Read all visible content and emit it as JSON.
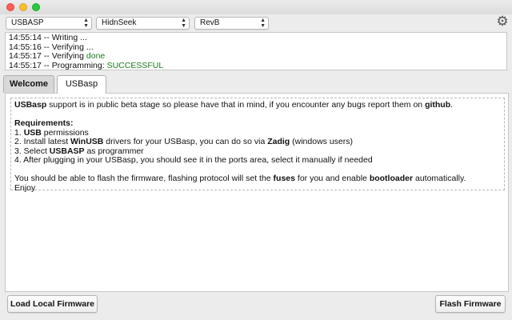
{
  "window": {
    "controls": {
      "close": "close",
      "minimize": "minimize",
      "zoom": "zoom"
    }
  },
  "toolbar": {
    "programmer": "USBASP",
    "firmware": "HidnSeek",
    "revision": "RevB",
    "settings_icon": "gear-icon"
  },
  "log": [
    {
      "time": "14:55:14",
      "sep": " -- ",
      "text": "Writing ...",
      "status": ""
    },
    {
      "time": "14:55:16",
      "sep": " -- ",
      "text": "Verifying ...",
      "status": ""
    },
    {
      "time": "14:55:17",
      "sep": " -- ",
      "text": "Verifying ",
      "status": "done"
    },
    {
      "time": "14:55:17",
      "sep": " -- ",
      "text": "Programming: ",
      "status": "SUCCESSFUL"
    }
  ],
  "tabs": [
    {
      "label": "Welcome"
    },
    {
      "label": "USBasp"
    }
  ],
  "notice": {
    "intro": {
      "b1": "USBasp",
      "t1": " support is in public beta stage so please have that in mind, if you encounter any bugs report them on ",
      "b2": "github",
      "t2": "."
    },
    "requirements_title": "Requirements:",
    "items": [
      {
        "pre": "1. ",
        "bold": "USB",
        "post": " permissions",
        "pre2": "",
        "bold2": "",
        "post2": ""
      },
      {
        "pre": "2. Install latest ",
        "bold": "WinUSB",
        "post": " drivers for your USBasp, you can do so via ",
        "pre2": "",
        "bold2": "Zadig",
        "post2": " (windows users)"
      },
      {
        "pre": "3. Select ",
        "bold": "USBASP",
        "post": " as programmer",
        "pre2": "",
        "bold2": "",
        "post2": ""
      },
      {
        "pre": "4. After plugging in your USBasp, you should see it in the ports area, select it manually if needed",
        "bold": "",
        "post": "",
        "pre2": "",
        "bold2": "",
        "post2": ""
      }
    ],
    "closing": {
      "t1": "You should be able to flash the firmware, flashing protocol will set the ",
      "b1": "fuses",
      "t2": " for you and enable ",
      "b2": "bootloader",
      "t3": " automatically."
    },
    "signoff": "Enjoy"
  },
  "footer": {
    "load_label": "Load Local Firmware",
    "flash_label": "Flash Firmware"
  }
}
